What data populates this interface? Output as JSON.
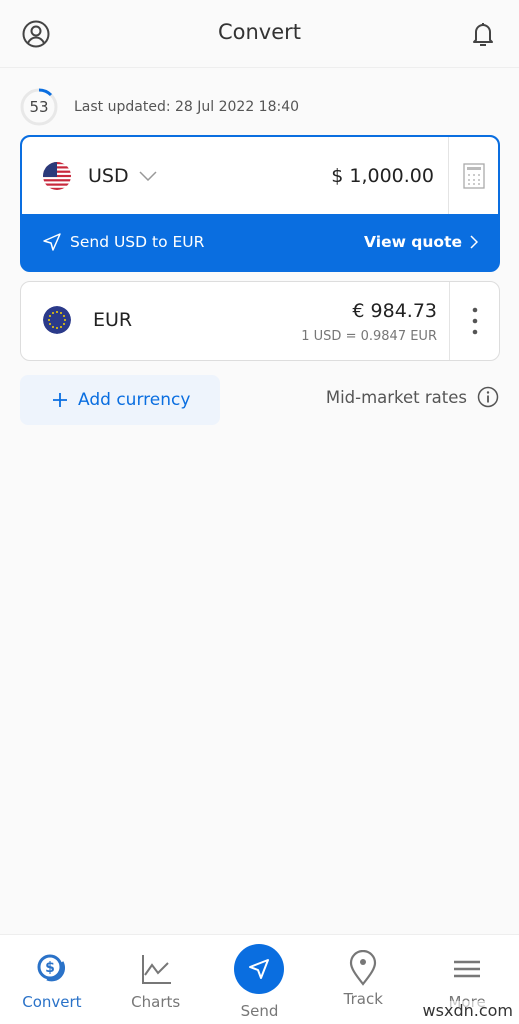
{
  "header": {
    "title": "Convert",
    "left_icon": "user-circle-icon",
    "right_icon": "bell-icon"
  },
  "status": {
    "countdown": "53",
    "countdown_progress": 0.12,
    "last_updated": "Last updated: 28 Jul 2022 18:40"
  },
  "source": {
    "code": "USD",
    "amount": "$ 1,000.00",
    "send_label": "Send USD to EUR",
    "quote_label": "View quote"
  },
  "target": {
    "code": "EUR",
    "amount": "€ 984.73",
    "rate": "1 USD = 0.9847 EUR"
  },
  "actions": {
    "add_currency": "Add currency",
    "mid_market": "Mid-market rates"
  },
  "nav": [
    {
      "label": "Convert",
      "active": true
    },
    {
      "label": "Charts"
    },
    {
      "label": "Send"
    },
    {
      "label": "Track"
    },
    {
      "label": "More"
    }
  ],
  "colors": {
    "accent": "#0a6ee0"
  },
  "watermark": "wsxdn.com"
}
